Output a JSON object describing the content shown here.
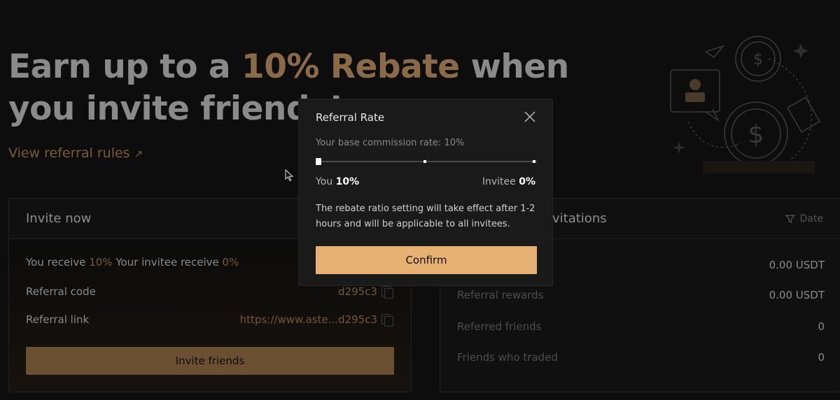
{
  "hero": {
    "title_part1": "Earn up to a ",
    "title_accent": "10% Rebate",
    "title_part2": " when",
    "title_line2": "you invite friends!",
    "view_rules": "View referral rules",
    "view_rules_icon": "arrow-up-right-icon"
  },
  "invite_card": {
    "heading": "Invite now",
    "receive_label": "You receive ",
    "receive_value": "10%",
    "invitee_label": " Your invitee receive ",
    "invitee_value": "0%",
    "code_label": "Referral code",
    "code_value": "d295c3",
    "link_label": "Referral link",
    "link_value": "https://www.aste...d295c3",
    "invite_button": "Invite friends"
  },
  "invitations_card": {
    "heading_visible": "vitations",
    "date_filter": "Date",
    "stats": [
      {
        "label": "",
        "value": "0.00 USDT"
      },
      {
        "label": "Referral rewards",
        "value": "0.00 USDT"
      },
      {
        "label": "Referred friends",
        "value": "0"
      },
      {
        "label": "Friends who traded",
        "value": "0"
      }
    ]
  },
  "modal": {
    "title": "Referral Rate",
    "base_rate": "Your base commission rate: 10%",
    "slider_value": 0,
    "you_label": "You",
    "you_value": "10%",
    "invitee_label": "Invitee",
    "invitee_value": "0%",
    "note": "The rebate ratio setting will take effect after 1-2 hours and will be applicable to all invitees.",
    "confirm": "Confirm"
  },
  "colors": {
    "accent": "#8a6a48",
    "confirm": "#e8b174",
    "invite_button": "#6b4f31"
  }
}
